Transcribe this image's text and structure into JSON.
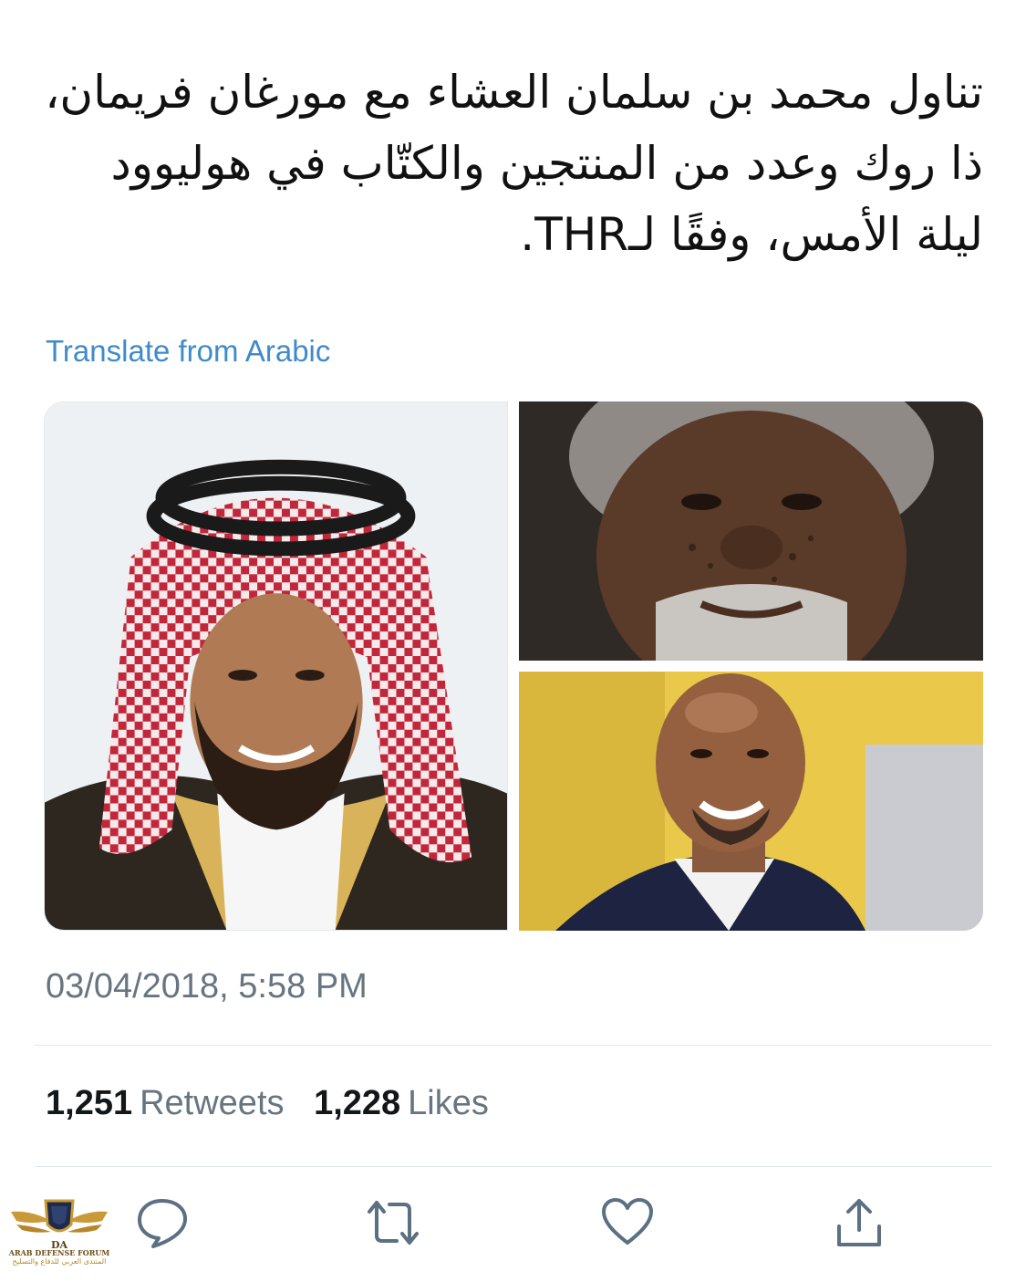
{
  "tweet": {
    "text": "تناول محمد بن سلمان العشاء مع مورغان فريمان، ذا روك وعدد من المنتجين والكتّاب في هوليوود ليلة الأمس، وفقًا لـTHR.",
    "translate_label": "Translate from Arabic",
    "timestamp": "03/04/2018, 5:58 PM"
  },
  "media": {
    "photo_count": 3,
    "left_photo_icon": "portrait-photo",
    "top_right_photo_icon": "portrait-photo",
    "bottom_right_photo_icon": "portrait-photo"
  },
  "stats": {
    "retweets_count": "1,251",
    "retweets_label": "Retweets",
    "likes_count": "1,228",
    "likes_label": "Likes"
  },
  "actions": [
    {
      "name": "reply",
      "icon": "speech-bubble-icon"
    },
    {
      "name": "retweet",
      "icon": "retweet-arrows-icon"
    },
    {
      "name": "like",
      "icon": "heart-icon"
    },
    {
      "name": "share",
      "icon": "share-upload-icon"
    }
  ],
  "watermark": {
    "monogram": "DA",
    "line1": "ARAB DEFENSE FORUM",
    "line2": "المنتدى العربي للدفاع والتسليح"
  },
  "colors": {
    "link": "#3f8bc9",
    "text": "#111111",
    "muted": "#66757f",
    "icon": "#5b7083",
    "divider": "#e1e8ed"
  }
}
